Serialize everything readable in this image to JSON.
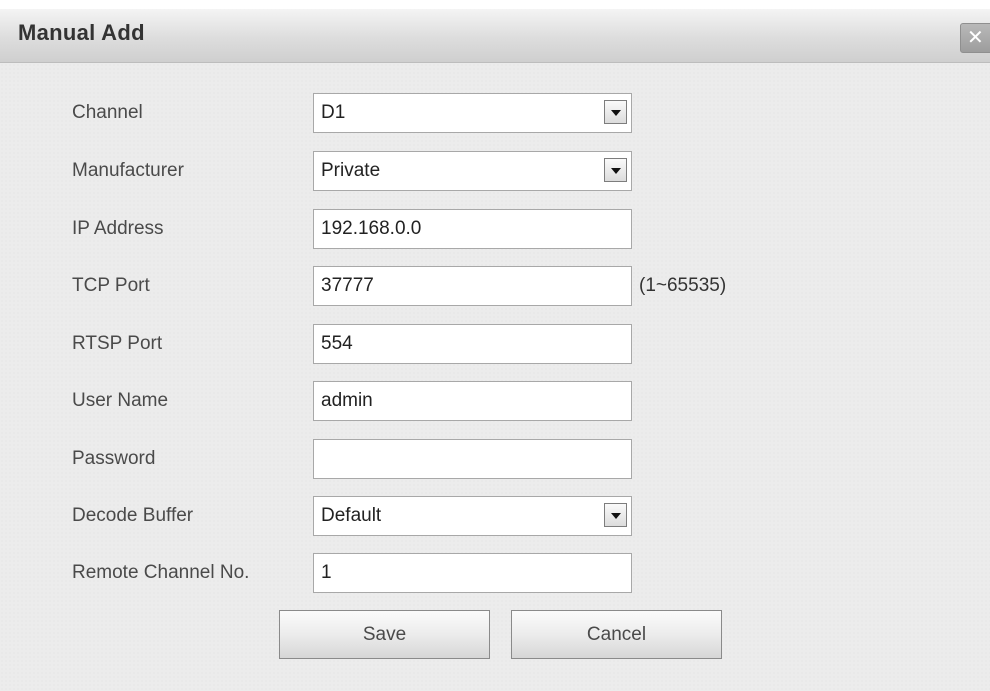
{
  "dialog": {
    "title": "Manual Add",
    "close_icon": "close-icon"
  },
  "form": {
    "channel": {
      "label": "Channel",
      "value": "D1"
    },
    "manufacturer": {
      "label": "Manufacturer",
      "value": "Private"
    },
    "ip_address": {
      "label": "IP Address",
      "value": "192.168.0.0"
    },
    "tcp_port": {
      "label": "TCP Port",
      "value": "37777",
      "hint": "(1~65535)"
    },
    "rtsp_port": {
      "label": "RTSP Port",
      "value": "554"
    },
    "user_name": {
      "label": "User Name",
      "value": "admin"
    },
    "password": {
      "label": "Password",
      "value": ""
    },
    "decode_buffer": {
      "label": "Decode Buffer",
      "value": "Default"
    },
    "remote_channel": {
      "label": "Remote Channel No.",
      "value": "1"
    }
  },
  "buttons": {
    "save": "Save",
    "cancel": "Cancel"
  }
}
